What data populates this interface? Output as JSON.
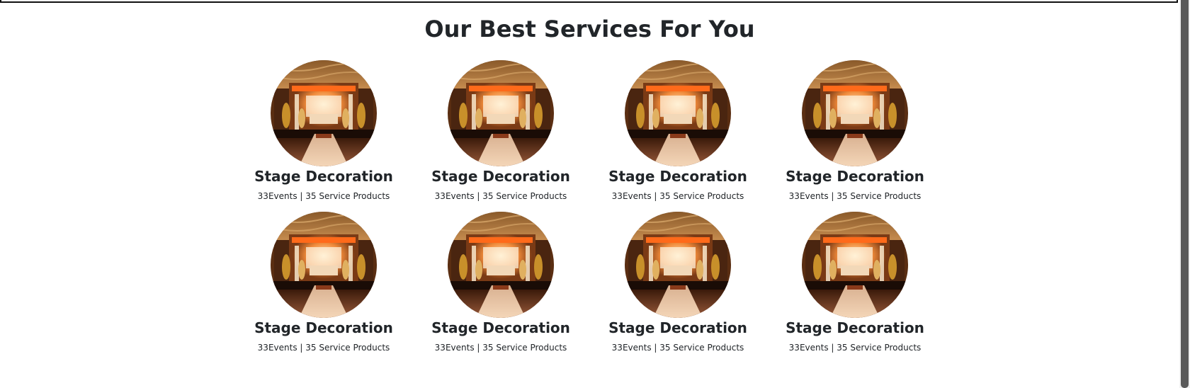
{
  "section": {
    "title": "Our Best Services For You"
  },
  "services": [
    {
      "title": "Stage Decoration",
      "meta": "33Events | 35 Service Products",
      "image": "stage-decoration-photo"
    },
    {
      "title": "Stage Decoration",
      "meta": "33Events | 35 Service Products",
      "image": "stage-decoration-photo"
    },
    {
      "title": "Stage Decoration",
      "meta": "33Events | 35 Service Products",
      "image": "stage-decoration-photo"
    },
    {
      "title": "Stage Decoration",
      "meta": "33Events | 35 Service Products",
      "image": "stage-decoration-photo"
    },
    {
      "title": "Stage Decoration",
      "meta": "33Events | 35 Service Products",
      "image": "stage-decoration-photo"
    },
    {
      "title": "Stage Decoration",
      "meta": "33Events | 35 Service Products",
      "image": "stage-decoration-photo"
    },
    {
      "title": "Stage Decoration",
      "meta": "33Events | 35 Service Products",
      "image": "stage-decoration-photo"
    },
    {
      "title": "Stage Decoration",
      "meta": "33Events | 35 Service Products",
      "image": "stage-decoration-photo"
    }
  ]
}
